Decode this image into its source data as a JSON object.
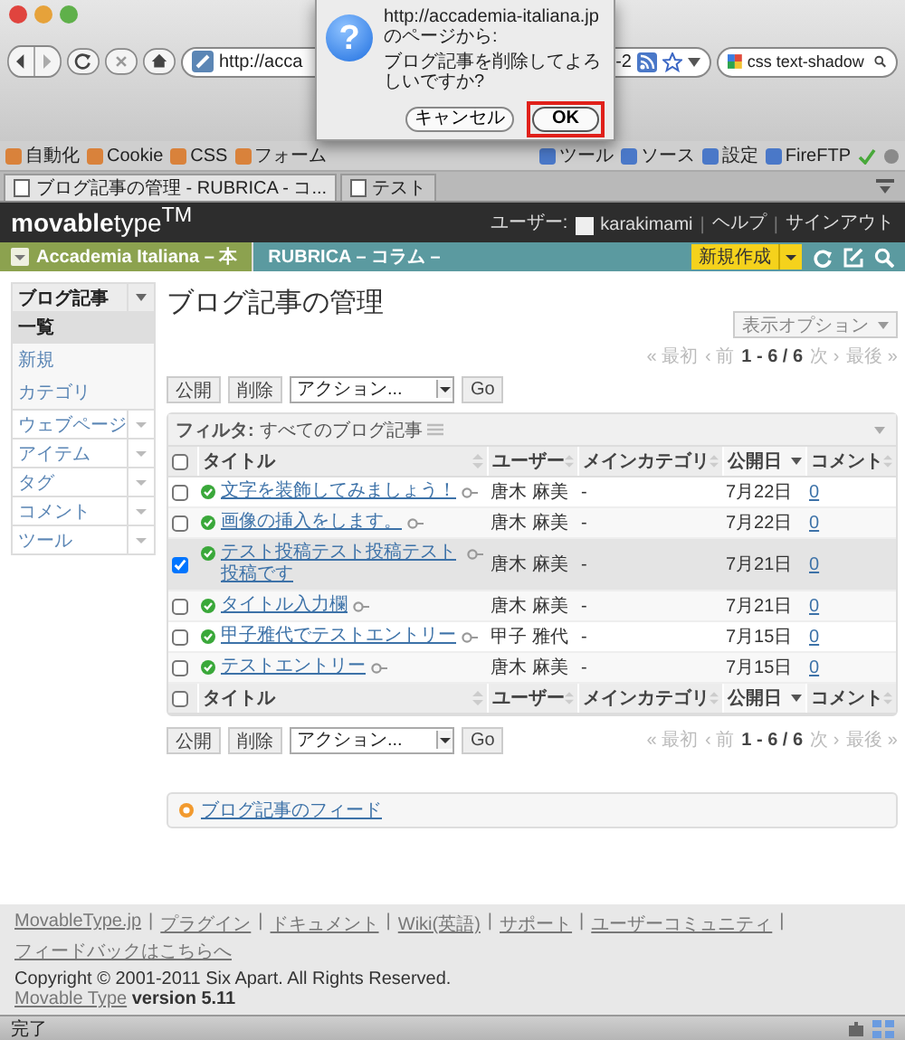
{
  "browser": {
    "url_start": "http://acca",
    "url_end": "-2",
    "search": "css text-shadow",
    "bookmarks_left": [
      {
        "label": "自動化"
      },
      {
        "label": "Cookie"
      },
      {
        "label": "CSS"
      },
      {
        "label": "フォーム"
      }
    ],
    "bookmarks_right": [
      {
        "label": "ツール"
      },
      {
        "label": "ソース"
      },
      {
        "label": "設定"
      },
      {
        "label": "FireFTP"
      }
    ],
    "tabs": [
      {
        "label": "ブログ記事の管理 - RUBRICA - コ...",
        "selected": true
      },
      {
        "label": "テスト",
        "selected": false
      }
    ],
    "status": "完了"
  },
  "dialog": {
    "icon": "?",
    "origin": "http://accademia-italiana.jp のページから:",
    "message": "ブログ記事を削除してよろしいですか?",
    "buttons": [
      {
        "label": "キャンセル",
        "default": false,
        "highlighted": false
      },
      {
        "label": "OK",
        "default": true,
        "highlighted": true
      }
    ]
  },
  "header": {
    "logo": "**movable**type$^{TM}$",
    "user_label": "ユーザー:",
    "username": "karakimami",
    "separator": "|",
    "links": [
      "ヘルプ",
      "サインアウト"
    ]
  },
  "nav": {
    "site": "Accademia Italiana – 本",
    "blog": "RUBRICA – コラム –",
    "create": "新規作成"
  },
  "sidebar": [
    {
      "label": "ブログ記事",
      "expanded": true,
      "children": [
        {
          "label": "一覧",
          "selected": true
        },
        {
          "label": "新規",
          "selected": false
        },
        {
          "label": "カテゴリ",
          "selected": false
        }
      ]
    },
    {
      "label": "ウェブページ",
      "expanded": false
    },
    {
      "label": "アイテム",
      "expanded": false
    },
    {
      "label": "タグ",
      "expanded": false
    },
    {
      "label": "コメント",
      "expanded": false
    },
    {
      "label": "ツール",
      "expanded": false
    }
  ],
  "page_title": "ブログ記事の管理",
  "display_options": "表示オプション",
  "pager_top": {
    "first": "« 最初",
    "prev": "‹ 前",
    "range": "1 - 6 / 6",
    "next": "次 ›",
    "last": "最後 »"
  },
  "actions_top": {
    "publish": "公開",
    "delete": "削除",
    "select": "アクション...",
    "go": "Go"
  },
  "table": {
    "filter_label": "フィルタ:",
    "filter_value": "すべてのブログ記事",
    "header": {
      "checked": false,
      "columns": [
        {
          "label": "タイトル",
          "sorted": false
        },
        {
          "label": "ユーザー",
          "sorted": false
        },
        {
          "label": "メインカテゴリ",
          "sorted": false
        },
        {
          "label": "公開日",
          "sorted": true
        },
        {
          "label": "コメント",
          "sorted": false
        }
      ]
    },
    "rows": [
      {
        "checked": false,
        "title": "文字を装飾してみましょう！",
        "user": "唐木 麻美",
        "category": "-",
        "date": "7月22日",
        "comments": "0"
      },
      {
        "checked": false,
        "title": "画像の挿入をします。",
        "user": "唐木 麻美",
        "category": "-",
        "date": "7月22日",
        "comments": "0"
      },
      {
        "checked": true,
        "title": "テスト投稿テスト投稿テスト投稿です",
        "user": "唐木 麻美",
        "category": "-",
        "date": "7月21日",
        "comments": "0"
      },
      {
        "checked": false,
        "title": "タイトル入力欄",
        "user": "唐木 麻美",
        "category": "-",
        "date": "7月21日",
        "comments": "0"
      },
      {
        "checked": false,
        "title": "甲子雅代でテストエントリー",
        "user": "甲子 雅代",
        "category": "-",
        "date": "7月15日",
        "comments": "0"
      },
      {
        "checked": false,
        "title": "テストエントリー",
        "user": "唐木 麻美",
        "category": "-",
        "date": "7月15日",
        "comments": "0"
      }
    ],
    "footer": {
      "checked": false,
      "columns": [
        {
          "label": "タイトル",
          "sorted": false
        },
        {
          "label": "ユーザー",
          "sorted": false
        },
        {
          "label": "メインカテゴリ",
          "sorted": false
        },
        {
          "label": "公開日",
          "sorted": true
        },
        {
          "label": "コメント",
          "sorted": false
        }
      ]
    }
  },
  "actions_bottom": {
    "publish": "公開",
    "delete": "削除",
    "select": "アクション...",
    "go": "Go"
  },
  "pager_bottom": {
    "first": "« 最初",
    "prev": "‹ 前",
    "range": "1 - 6 / 6",
    "next": "次 ›",
    "last": "最後 »"
  },
  "feed_link": "ブログ記事のフィード",
  "footer": {
    "separator": "|",
    "links": [
      "MovableType.jp",
      "プラグイン",
      "ドキュメント",
      "Wiki(英語)",
      "サポート",
      "ユーザーコミュニティ",
      "フィードバックはこちらへ"
    ],
    "copyright": "Copyright © 2001-2011 Six Apart. All Rights Reserved.",
    "product_link": "Movable Type",
    "version": "version 5.11"
  }
}
